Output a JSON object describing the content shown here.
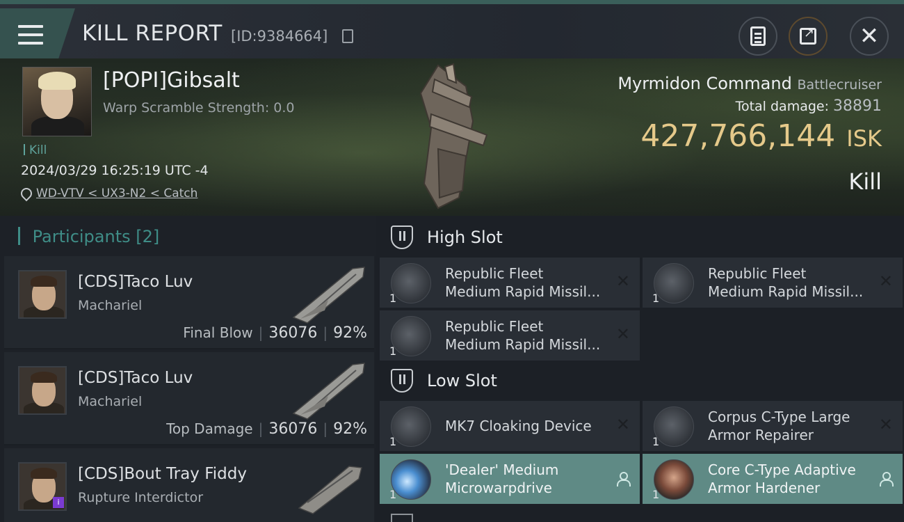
{
  "header": {
    "title": "KILL REPORT",
    "report_id": "[ID:9384664]",
    "icons": [
      "menu-icon",
      "copy-icon",
      "clipboard-icon",
      "share-icon",
      "close-icon"
    ],
    "close_glyph": "✕"
  },
  "victim": {
    "name": "[POPI]Gibsalt",
    "warp_scramble": "Warp Scramble Strength: 0.0",
    "tag": "Kill",
    "datetime": "2024/03/29 16:25:19 UTC -4",
    "location": "WD-VTV < UX3-N2 < Catch",
    "ship_name": "Myrmidon Command",
    "ship_class": "Battlecruiser",
    "total_damage_label": "Total damage:",
    "total_damage": "38891",
    "isk_value": "427,766,144",
    "isk_unit": "ISK",
    "result": "Kill"
  },
  "participants": {
    "title": "Participants",
    "count": "[2]",
    "rows": [
      {
        "name": "[CDS]Taco Luv",
        "ship": "Machariel",
        "role": "Final Blow",
        "damage": "36076",
        "percent": "92%"
      },
      {
        "name": "[CDS]Taco Luv",
        "ship": "Machariel",
        "role": "Top Damage",
        "damage": "36076",
        "percent": "92%"
      },
      {
        "name": "[CDS]Bout Tray Fiddy",
        "ship": "Rupture Interdictor",
        "badge": "i"
      }
    ],
    "separator": "|"
  },
  "fitting": {
    "high_slot_label": "High Slot",
    "low_slot_label": "Low Slot",
    "high": [
      {
        "name1": "Republic Fleet",
        "name2": "Medium Rapid Missil...",
        "qty": "1",
        "status": "destroyed"
      },
      {
        "name1": "Republic Fleet",
        "name2": "Medium Rapid Missil...",
        "qty": "1",
        "status": "destroyed"
      },
      {
        "name1": "Republic Fleet",
        "name2": "Medium Rapid Missil...",
        "qty": "1",
        "status": "destroyed"
      }
    ],
    "low": [
      {
        "name1": "MK7 Cloaking Device",
        "name2": "",
        "qty": "1",
        "status": "destroyed"
      },
      {
        "name1": "Corpus C-Type Large",
        "name2": "Armor Repairer",
        "qty": "1",
        "status": "destroyed"
      },
      {
        "name1": "'Dealer' Medium",
        "name2": "Microwarpdrive",
        "qty": "1",
        "status": "dropped"
      },
      {
        "name1": "Core C-Type Adaptive",
        "name2": " Armor Hardener",
        "qty": "1",
        "status": "dropped"
      }
    ],
    "x_glyph": "✕"
  },
  "colors": {
    "accent": "#3f8d87",
    "isk": "#e5c98a",
    "dropped_bg": "#5f8a85"
  }
}
